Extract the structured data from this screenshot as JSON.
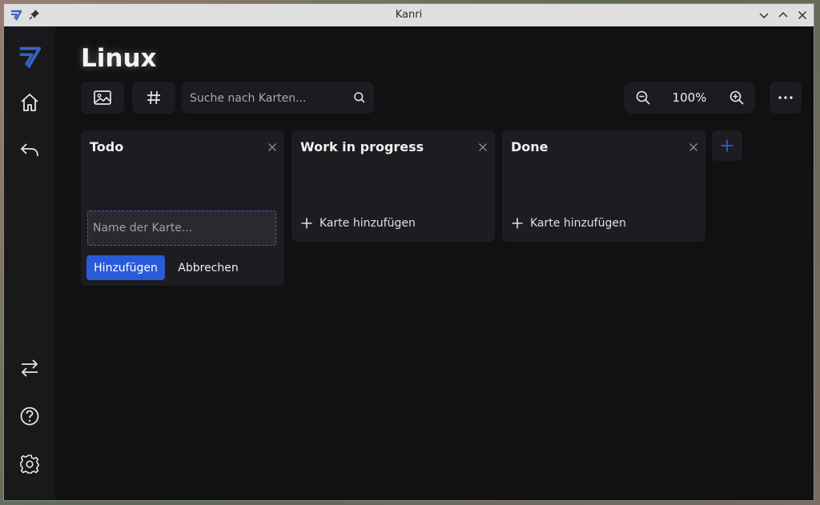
{
  "window": {
    "title": "Kanri",
    "app_icon": "kanri-logo-icon",
    "pin_icon": "pin-icon"
  },
  "titlebar_buttons": [
    "chevron-down-icon",
    "chevron-up-icon",
    "close-icon"
  ],
  "sidebar": {
    "logo": "kanri-logo-icon",
    "items": [
      {
        "icon": "home-icon"
      },
      {
        "icon": "back-arrow-icon"
      },
      {
        "icon": "swap-arrows-icon"
      },
      {
        "icon": "help-icon"
      },
      {
        "icon": "gear-icon"
      }
    ]
  },
  "board": {
    "title": "Linux"
  },
  "toolbar": {
    "background_icon": "image-icon",
    "tags_icon": "hash-icon",
    "search_placeholder": "Suche nach Karten...",
    "search_icon": "search-icon",
    "zoom_out_icon": "zoom-out-icon",
    "zoom_level": "100%",
    "zoom_in_icon": "zoom-in-icon",
    "more_icon": "more-horizontal-icon"
  },
  "columns": [
    {
      "title": "Todo",
      "new_card_placeholder": "Name der Karte...",
      "add_label": "Hinzufügen",
      "cancel_label": "Abbrechen"
    },
    {
      "title": "Work in progress",
      "add_card_label": "Karte hinzufügen"
    },
    {
      "title": "Done",
      "add_card_label": "Karte hinzufügen"
    }
  ],
  "colors": {
    "accent": "#2a5bd7",
    "logo": "#3a63c4",
    "background": "#111113",
    "sidebar": "#19191c",
    "column": "#1d1d21",
    "text": "#f0f0f0"
  }
}
